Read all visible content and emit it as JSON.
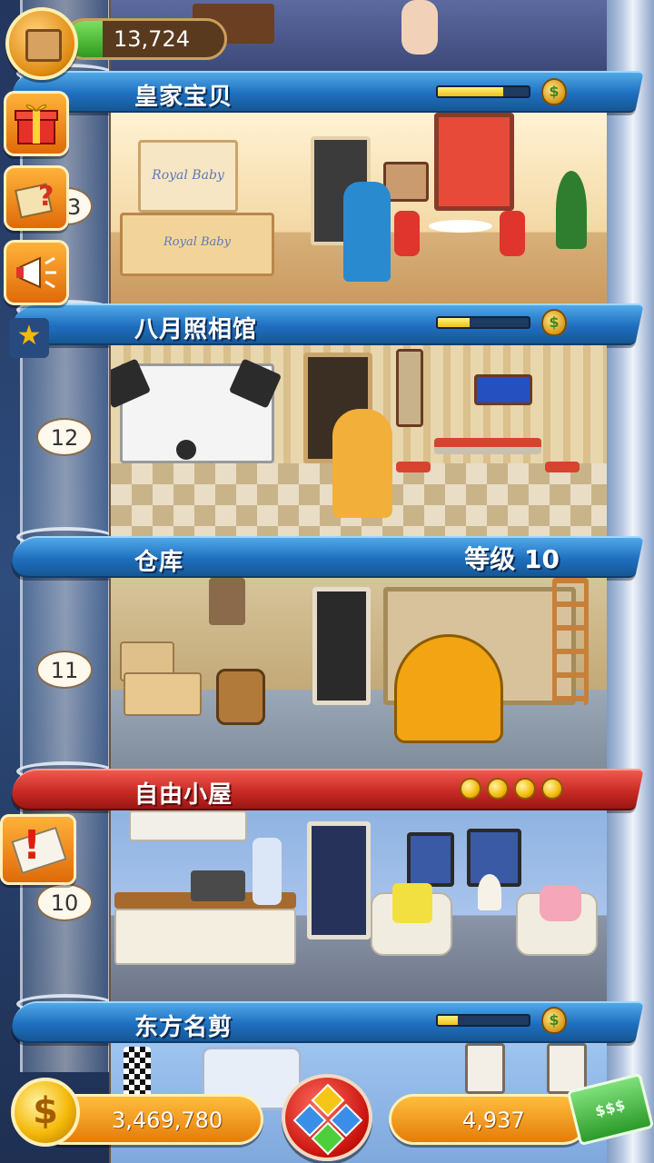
{
  "hud": {
    "top_resource_value": "13,724",
    "coins_value": "3,469,780",
    "bucks_value": "4,937",
    "coin_symbol": "$"
  },
  "floors": [
    {
      "id": "royal-baby",
      "name": "皇家宝贝",
      "floor_number": "13",
      "progress_fraction": 0.72,
      "banner_color": "blue",
      "reward_icon": "moneybag-icon"
    },
    {
      "id": "august-photo",
      "name": "八月照相馆",
      "floor_number": "12",
      "progress_fraction": 0.35,
      "banner_color": "blue",
      "reward_icon": "moneybag-icon"
    },
    {
      "id": "warehouse",
      "name": "仓库",
      "floor_number": "11",
      "level_label": "等级 10",
      "banner_color": "blue"
    },
    {
      "id": "free-cabin",
      "name": "自由小屋",
      "floor_number": "10",
      "stars": 4,
      "banner_color": "red"
    },
    {
      "id": "oriental-cut",
      "name": "东方名剪",
      "floor_number": "",
      "progress_fraction": 0.22,
      "banner_color": "blue",
      "reward_icon": "moneybag-icon"
    }
  ],
  "room_signs": {
    "royal_sign_1": "Royal Baby",
    "royal_sign_2": "Royal Baby"
  },
  "colors": {
    "banner_blue": "#1f6fbf",
    "banner_red": "#c92a25",
    "hud_orange": "#e47c0b",
    "coin_gold": "#f5b90a"
  },
  "icons": [
    "crate-icon",
    "gift-icon",
    "quest-icon",
    "megaphone-icon",
    "star-icon",
    "mail-alert-icon",
    "coin-icon",
    "menu-gems-icon",
    "cash-icon",
    "moneybag-icon"
  ]
}
